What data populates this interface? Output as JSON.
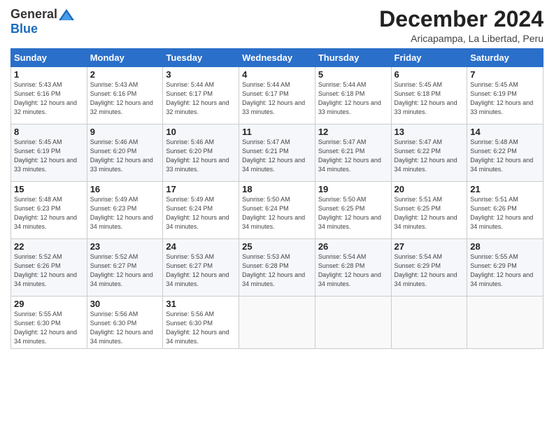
{
  "header": {
    "logo_general": "General",
    "logo_blue": "Blue",
    "month_title": "December 2024",
    "location": "Aricapampa, La Libertad, Peru"
  },
  "weekdays": [
    "Sunday",
    "Monday",
    "Tuesday",
    "Wednesday",
    "Thursday",
    "Friday",
    "Saturday"
  ],
  "weeks": [
    [
      {
        "day": "1",
        "sunrise": "5:43 AM",
        "sunset": "6:16 PM",
        "daylight": "12 hours and 32 minutes."
      },
      {
        "day": "2",
        "sunrise": "5:43 AM",
        "sunset": "6:16 PM",
        "daylight": "12 hours and 32 minutes."
      },
      {
        "day": "3",
        "sunrise": "5:44 AM",
        "sunset": "6:17 PM",
        "daylight": "12 hours and 32 minutes."
      },
      {
        "day": "4",
        "sunrise": "5:44 AM",
        "sunset": "6:17 PM",
        "daylight": "12 hours and 33 minutes."
      },
      {
        "day": "5",
        "sunrise": "5:44 AM",
        "sunset": "6:18 PM",
        "daylight": "12 hours and 33 minutes."
      },
      {
        "day": "6",
        "sunrise": "5:45 AM",
        "sunset": "6:18 PM",
        "daylight": "12 hours and 33 minutes."
      },
      {
        "day": "7",
        "sunrise": "5:45 AM",
        "sunset": "6:19 PM",
        "daylight": "12 hours and 33 minutes."
      }
    ],
    [
      {
        "day": "8",
        "sunrise": "5:45 AM",
        "sunset": "6:19 PM",
        "daylight": "12 hours and 33 minutes."
      },
      {
        "day": "9",
        "sunrise": "5:46 AM",
        "sunset": "6:20 PM",
        "daylight": "12 hours and 33 minutes."
      },
      {
        "day": "10",
        "sunrise": "5:46 AM",
        "sunset": "6:20 PM",
        "daylight": "12 hours and 33 minutes."
      },
      {
        "day": "11",
        "sunrise": "5:47 AM",
        "sunset": "6:21 PM",
        "daylight": "12 hours and 34 minutes."
      },
      {
        "day": "12",
        "sunrise": "5:47 AM",
        "sunset": "6:21 PM",
        "daylight": "12 hours and 34 minutes."
      },
      {
        "day": "13",
        "sunrise": "5:47 AM",
        "sunset": "6:22 PM",
        "daylight": "12 hours and 34 minutes."
      },
      {
        "day": "14",
        "sunrise": "5:48 AM",
        "sunset": "6:22 PM",
        "daylight": "12 hours and 34 minutes."
      }
    ],
    [
      {
        "day": "15",
        "sunrise": "5:48 AM",
        "sunset": "6:23 PM",
        "daylight": "12 hours and 34 minutes."
      },
      {
        "day": "16",
        "sunrise": "5:49 AM",
        "sunset": "6:23 PM",
        "daylight": "12 hours and 34 minutes."
      },
      {
        "day": "17",
        "sunrise": "5:49 AM",
        "sunset": "6:24 PM",
        "daylight": "12 hours and 34 minutes."
      },
      {
        "day": "18",
        "sunrise": "5:50 AM",
        "sunset": "6:24 PM",
        "daylight": "12 hours and 34 minutes."
      },
      {
        "day": "19",
        "sunrise": "5:50 AM",
        "sunset": "6:25 PM",
        "daylight": "12 hours and 34 minutes."
      },
      {
        "day": "20",
        "sunrise": "5:51 AM",
        "sunset": "6:25 PM",
        "daylight": "12 hours and 34 minutes."
      },
      {
        "day": "21",
        "sunrise": "5:51 AM",
        "sunset": "6:26 PM",
        "daylight": "12 hours and 34 minutes."
      }
    ],
    [
      {
        "day": "22",
        "sunrise": "5:52 AM",
        "sunset": "6:26 PM",
        "daylight": "12 hours and 34 minutes."
      },
      {
        "day": "23",
        "sunrise": "5:52 AM",
        "sunset": "6:27 PM",
        "daylight": "12 hours and 34 minutes."
      },
      {
        "day": "24",
        "sunrise": "5:53 AM",
        "sunset": "6:27 PM",
        "daylight": "12 hours and 34 minutes."
      },
      {
        "day": "25",
        "sunrise": "5:53 AM",
        "sunset": "6:28 PM",
        "daylight": "12 hours and 34 minutes."
      },
      {
        "day": "26",
        "sunrise": "5:54 AM",
        "sunset": "6:28 PM",
        "daylight": "12 hours and 34 minutes."
      },
      {
        "day": "27",
        "sunrise": "5:54 AM",
        "sunset": "6:29 PM",
        "daylight": "12 hours and 34 minutes."
      },
      {
        "day": "28",
        "sunrise": "5:55 AM",
        "sunset": "6:29 PM",
        "daylight": "12 hours and 34 minutes."
      }
    ],
    [
      {
        "day": "29",
        "sunrise": "5:55 AM",
        "sunset": "6:30 PM",
        "daylight": "12 hours and 34 minutes."
      },
      {
        "day": "30",
        "sunrise": "5:56 AM",
        "sunset": "6:30 PM",
        "daylight": "12 hours and 34 minutes."
      },
      {
        "day": "31",
        "sunrise": "5:56 AM",
        "sunset": "6:30 PM",
        "daylight": "12 hours and 34 minutes."
      },
      null,
      null,
      null,
      null
    ]
  ]
}
